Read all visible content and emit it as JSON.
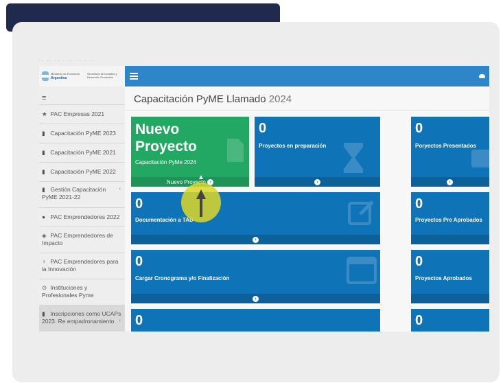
{
  "header": {
    "logo_ministry": "Ministerio de Economía",
    "logo_country": "Argentina",
    "logo_secretary": "Secretaría de Industria y Desarrollo Productivo"
  },
  "sidebar": {
    "items": [
      {
        "icon": "★",
        "label": "PAC Empresas 2021"
      },
      {
        "icon": "▮",
        "label": "Capacitación PyME 2023"
      },
      {
        "icon": "▮",
        "label": "Capacitación PyME 2021"
      },
      {
        "icon": "▮",
        "label": "Capacitación PyME 2022"
      },
      {
        "icon": "▮",
        "label": "Gestión Capacitación PyME 2021-22"
      },
      {
        "icon": "●",
        "label": "PAC Emprendedores 2022"
      },
      {
        "icon": "◈",
        "label": "PAC Emprendedores de Impacto"
      },
      {
        "icon": "♀",
        "label": "PAC Emprendedores para la Innovación"
      },
      {
        "icon": "⊙",
        "label": "Instituciones y Profesionales Pyme"
      },
      {
        "icon": "▮",
        "label": "Inscripciones como UCAPs 2023. Re empadronamiento"
      }
    ]
  },
  "main": {
    "title": "Capacitación PyME Llamado",
    "title_year": "2024",
    "new_project": {
      "title_line1": "Nuevo",
      "title_line2": "Proyecto",
      "subtitle": "Capacitación PyMe 2024",
      "footer": "Nuevo Proyecto"
    },
    "tiles": {
      "preparacion": {
        "count": "0",
        "label": "Proyectos en preparación"
      },
      "presentados": {
        "count": "0",
        "label": "Poryectos Presentados"
      },
      "tad": {
        "count": "0",
        "label": "Documentación a TAD"
      },
      "pre_aprobados": {
        "count": "0",
        "label": "Proyectos Pre Aprobados"
      },
      "cronograma": {
        "count": "0",
        "label": "Cargar Cronograma y/o Finalización"
      },
      "aprobados": {
        "count": "0",
        "label": "Proyectos Aprobados"
      },
      "row4_left": {
        "count": "0"
      },
      "row4_right": {
        "count": "0"
      }
    }
  },
  "colors": {
    "appbar": "#2e86c8",
    "tile_blue": "#0f73b7",
    "tile_green": "#22a863",
    "cursor_highlight": "#dcd728"
  }
}
